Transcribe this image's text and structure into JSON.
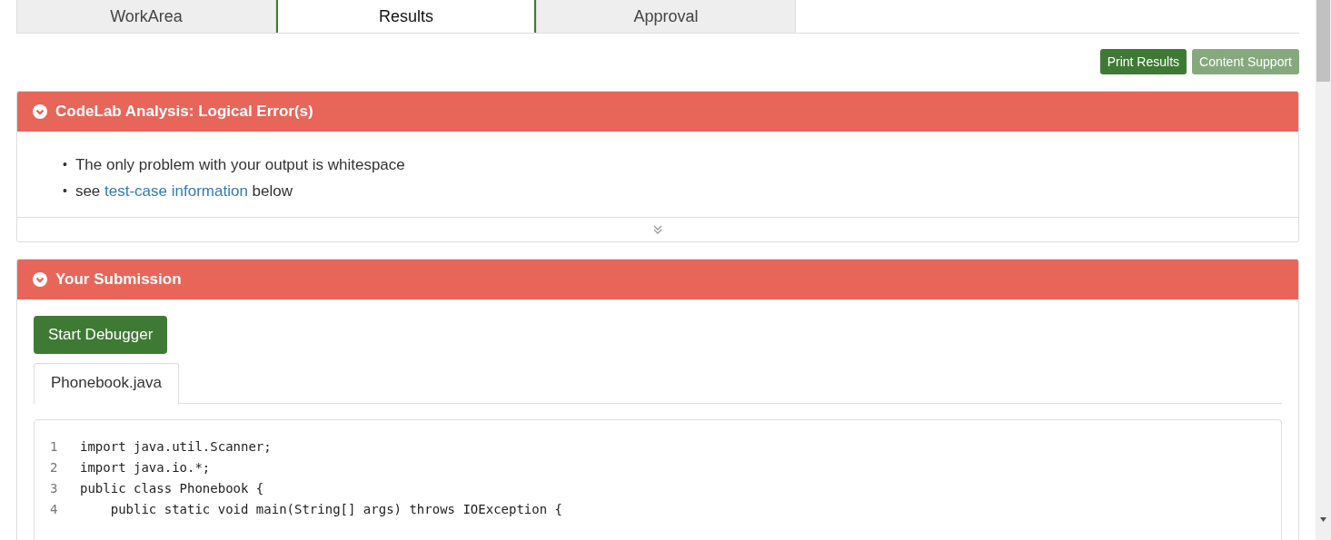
{
  "tabs": [
    {
      "label": "WorkArea",
      "selected": false
    },
    {
      "label": "Results",
      "selected": true
    },
    {
      "label": "Approval",
      "selected": false
    }
  ],
  "actions": [
    {
      "label": "Print Results",
      "disabled": false
    },
    {
      "label": "Content Support",
      "disabled": true
    }
  ],
  "panels": [
    {
      "kind": "analysis",
      "title": "CodeLab Analysis: Logical Error(s)",
      "expanded": true,
      "items": [
        {
          "bullet": "•",
          "text": "The only problem with your output is whitespace"
        },
        {
          "bullet": "•",
          "text": "see",
          "link": "test-case information",
          "after": "below"
        }
      ]
    },
    {
      "kind": "submission",
      "title": "Your Submission",
      "expanded": true,
      "button": "Start Debugger",
      "files": [
        {
          "label": "Phonebook.java",
          "selected": true
        }
      ],
      "code": [
        {
          "number": "1",
          "text": "import java.util.Scanner;"
        },
        {
          "number": "2",
          "text": "import java.io.*;"
        },
        {
          "number": "3",
          "text": "public class Phonebook {"
        },
        {
          "number": "4",
          "text": "    public static void main(String[] args) throws IOException {"
        }
      ]
    }
  ]
}
